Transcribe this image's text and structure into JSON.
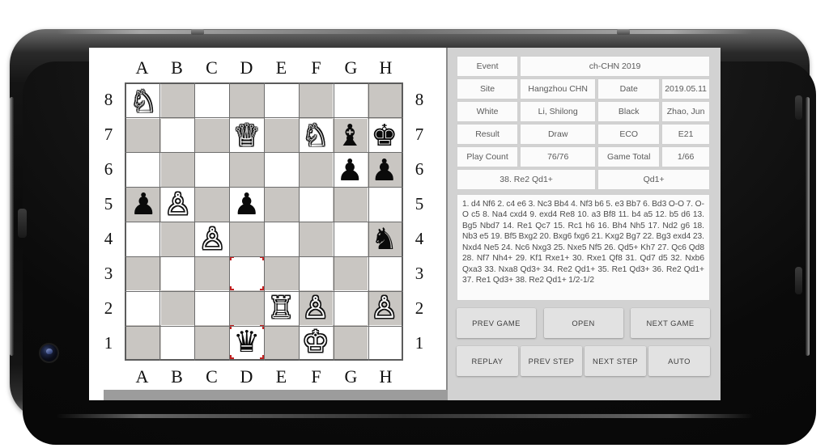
{
  "device": {
    "camera": "front-camera-lens",
    "buttons": [
      "power-button",
      "volume-up-button",
      "volume-down-button"
    ]
  },
  "board": {
    "files": [
      "A",
      "B",
      "C",
      "D",
      "E",
      "F",
      "G",
      "H"
    ],
    "ranks": [
      "8",
      "7",
      "6",
      "5",
      "4",
      "3",
      "2",
      "1"
    ],
    "light_color": "#ffffff",
    "dark_color": "#c9c6c2",
    "highlight_color": "#c32020",
    "highlighted_squares": [
      "d3",
      "d1"
    ],
    "pieces": [
      {
        "square": "a8",
        "piece": "white-knight",
        "glyph": "♘"
      },
      {
        "square": "d7",
        "piece": "white-queen",
        "glyph": "♕"
      },
      {
        "square": "f7",
        "piece": "white-knight",
        "glyph": "♘"
      },
      {
        "square": "g7",
        "piece": "black-bishop",
        "glyph": "♝"
      },
      {
        "square": "h7",
        "piece": "black-king",
        "glyph": "♚"
      },
      {
        "square": "g6",
        "piece": "black-pawn",
        "glyph": "♟"
      },
      {
        "square": "h6",
        "piece": "black-pawn",
        "glyph": "♟"
      },
      {
        "square": "a5",
        "piece": "black-pawn",
        "glyph": "♟"
      },
      {
        "square": "b5",
        "piece": "white-pawn",
        "glyph": "♙"
      },
      {
        "square": "d5",
        "piece": "black-pawn",
        "glyph": "♟"
      },
      {
        "square": "c4",
        "piece": "white-pawn",
        "glyph": "♙"
      },
      {
        "square": "h4",
        "piece": "black-knight",
        "glyph": "♞"
      },
      {
        "square": "e2",
        "piece": "white-rook",
        "glyph": "♖"
      },
      {
        "square": "f2",
        "piece": "white-pawn",
        "glyph": "♙"
      },
      {
        "square": "h2",
        "piece": "white-pawn",
        "glyph": "♙"
      },
      {
        "square": "d1",
        "piece": "black-queen",
        "glyph": "♛"
      },
      {
        "square": "f1",
        "piece": "white-king",
        "glyph": "♔"
      }
    ]
  },
  "info": {
    "event_label": "Event",
    "event_value": "ch-CHN 2019",
    "site_label": "Site",
    "site_value": "Hangzhou CHN",
    "date_label": "Date",
    "date_value": "2019.05.11",
    "white_label": "White",
    "white_value": "Li, Shilong",
    "black_label": "Black",
    "black_value": "Zhao, Jun",
    "result_label": "Result",
    "result_value": "Draw",
    "eco_label": "ECO",
    "eco_value": "E21",
    "play_count_label": "Play Count",
    "play_count_value": "76/76",
    "game_total_label": "Game Total",
    "game_total_value": "1/66",
    "current_move_full": "38. Re2 Qd1+",
    "current_move_short": "Qd1+",
    "moves": "1. d4 Nf6 2. c4 e6 3. Nc3 Bb4 4. Nf3 b6 5. e3 Bb7 6. Bd3 O-O 7. O-O c5 8. Na4 cxd4 9. exd4 Re8 10. a3 Bf8 11. b4 a5 12. b5 d6 13. Bg5 Nbd7 14. Re1 Qc7 15. Rc1 h6 16. Bh4 Nh5 17. Nd2 g6 18. Nb3 e5 19. Bf5 Bxg2 20. Bxg6 fxg6 21. Kxg2 Bg7 22. Bg3 exd4 23. Nxd4 Ne5 24. Nc6 Nxg3 25. Nxe5 Nf5 26. Qd5+ Kh7 27. Qc6 Qd8 28. Nf7 Nh4+ 29. Kf1 Rxe1+ 30. Rxe1 Qf8 31. Qd7 d5 32. Nxb6 Qxa3 33. Nxa8 Qd3+ 34. Re2 Qd1+ 35. Re1 Qd3+ 36. Re2 Qd1+ 37. Re1 Qd3+ 38. Re2 Qd1+ 1/2-1/2"
  },
  "controls": {
    "row1": [
      {
        "id": "prev-game",
        "label": "PREV GAME"
      },
      {
        "id": "open",
        "label": "OPEN"
      },
      {
        "id": "next-game",
        "label": "NEXT GAME"
      }
    ],
    "row2": [
      {
        "id": "replay",
        "label": "REPLAY"
      },
      {
        "id": "prev-step",
        "label": "PREV STEP"
      },
      {
        "id": "next-step",
        "label": "NEXT STEP"
      },
      {
        "id": "auto",
        "label": "AUTO"
      }
    ]
  }
}
